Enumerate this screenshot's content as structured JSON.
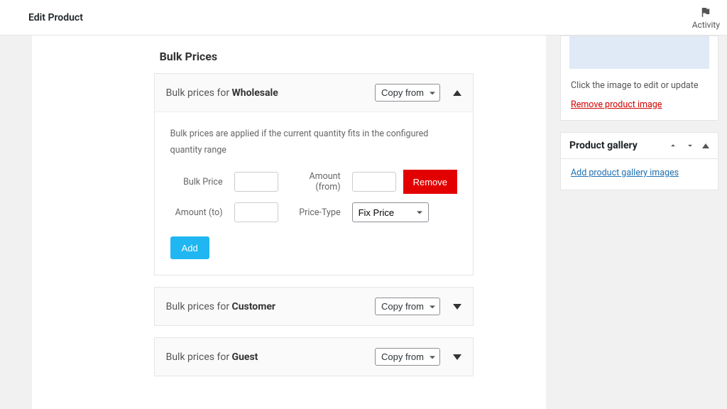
{
  "top": {
    "title": "Edit Product",
    "activity_label": "Activity"
  },
  "bulk": {
    "heading": "Bulk Prices",
    "help": "Bulk prices are applied if the current quantity fits in the configured quantity range",
    "copy_from_label": "Copy from",
    "labels": {
      "prefix": "Bulk prices for ",
      "bulk_price": "Bulk Price",
      "amount_from": "Amount (from)",
      "amount_to": "Amount (to)",
      "price_type": "Price-Type"
    },
    "roles": {
      "wholesale": "Wholesale",
      "customer": "Customer",
      "guest": "Guest"
    },
    "row": {
      "bulk_price_value": "",
      "amount_from_value": "",
      "amount_to_value": "",
      "price_type_value": "Fix Price"
    },
    "buttons": {
      "remove": "Remove",
      "add": "Add"
    }
  },
  "image_box": {
    "caption": "Click the image to edit or update",
    "remove_link": "Remove product image"
  },
  "gallery_box": {
    "title": "Product gallery",
    "add_link": "Add product gallery images"
  }
}
